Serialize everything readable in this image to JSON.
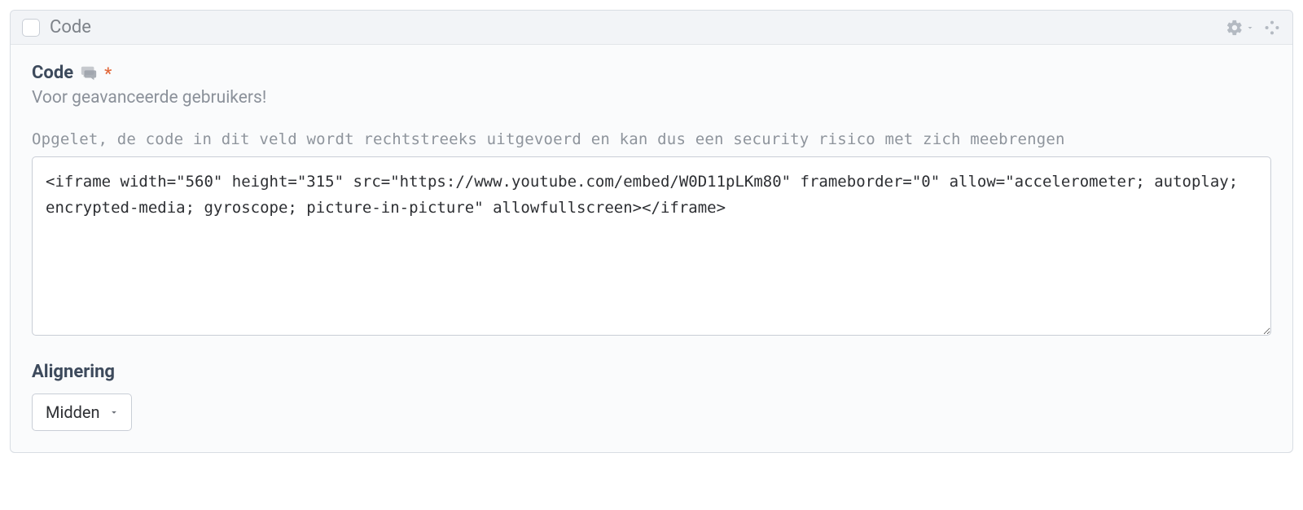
{
  "header": {
    "title": "Code"
  },
  "field": {
    "label": "Code",
    "required_mark": "*",
    "subtitle": "Voor geavanceerde gebruikers!",
    "warning": "Opgelet, de code in dit veld wordt rechtstreeks uitgevoerd en kan dus een security risico met zich meebrengen",
    "value": "<iframe width=\"560\" height=\"315\" src=\"https://www.youtube.com/embed/W0D11pLKm80\" frameborder=\"0\" allow=\"accelerometer; autoplay; encrypted-media; gyroscope; picture-in-picture\" allowfullscreen></iframe>"
  },
  "align": {
    "label": "Alignering",
    "value": "Midden"
  }
}
